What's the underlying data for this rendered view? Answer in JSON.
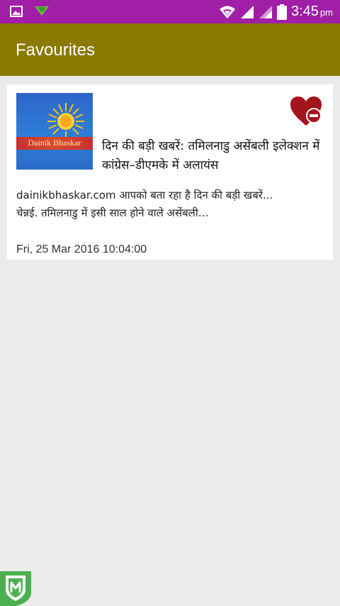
{
  "status_bar": {
    "icons": [
      "gallery-icon",
      "download-arrow-icon",
      "wifi-icon",
      "signal-icon",
      "signal-icon-2",
      "battery-icon"
    ],
    "time": "3:45",
    "ampm": "pm",
    "color": "#a11ea6"
  },
  "app_bar": {
    "title": "Favourites",
    "color": "#8a7a04"
  },
  "favourites": [
    {
      "thumbnail_label": "Dainik Bhaskar",
      "headline": "दिन की बड़ी खबरें: तमिलनाडु असेंबली इलेक्शन में कांग्रेस–डीएमके में अलायंस",
      "source": "dainikbhaskar.com",
      "summary_part1": "आपको बता रहा है दिन की बड़ी खबरें...",
      "summary_part2": "चेन्नई. तमिलनाडु में इसी साल होने वाले असेंबली…",
      "date": "Fri, 25 Mar 2016 10:04:00",
      "remove_icon": "heart-minus-icon",
      "remove_color": "#a3141b"
    }
  ],
  "badge": {
    "icon": "shield-m-icon",
    "color": "#4caf50"
  }
}
